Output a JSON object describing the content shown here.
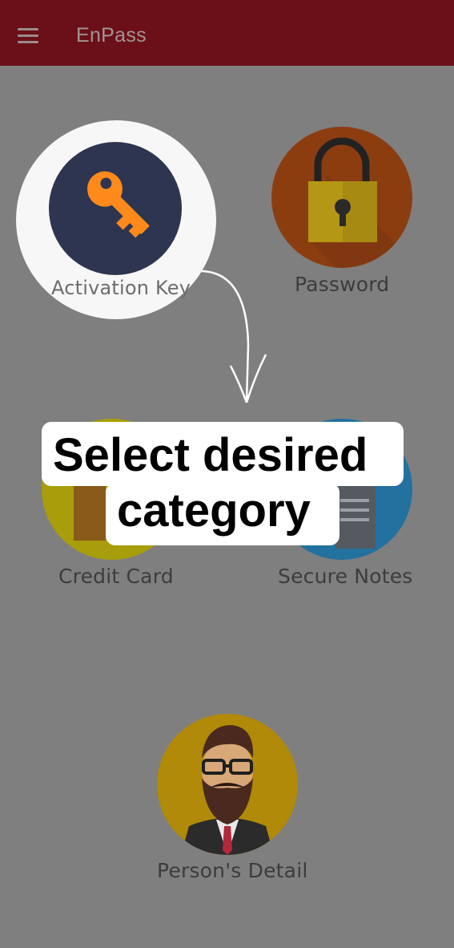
{
  "appbar": {
    "title": "EnPass",
    "menu_icon": "hamburger-menu-icon"
  },
  "categories": [
    {
      "label": "Activation Key",
      "icon": "key-icon",
      "color": "#2d3550",
      "highlighted": true
    },
    {
      "label": "Password",
      "icon": "padlock-icon",
      "color": "#a8480e"
    },
    {
      "label": "Credit Card",
      "icon": "wallet-icon",
      "color": "#a89d0a"
    },
    {
      "label": "Secure Notes",
      "icon": "notes-icon",
      "color": "#23719e"
    },
    {
      "label": "Person's Detail",
      "icon": "person-avatar-icon",
      "color": "#b08a08"
    }
  ],
  "overlay": {
    "line1": "Select desired",
    "line2": "category"
  },
  "colors": {
    "appbar": "#6b1018",
    "background": "#7f7f7f",
    "key_accent": "#ff8a1c"
  }
}
